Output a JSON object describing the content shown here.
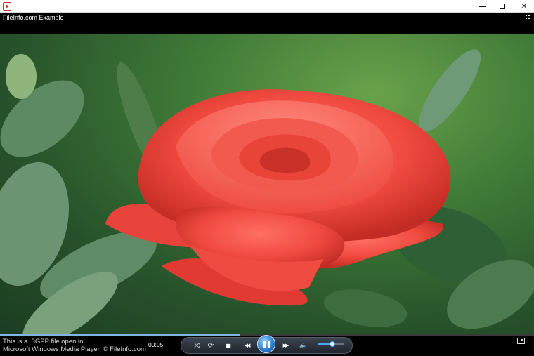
{
  "window": {
    "title": "",
    "controls": {
      "minimize_icon": "minimize-icon",
      "maximize_icon": "maximize-icon",
      "close_glyph": "✕"
    }
  },
  "header": {
    "title": "FileInfo.com Example"
  },
  "video": {
    "subject": "red-rose-image"
  },
  "playback": {
    "progress": 0.45,
    "elapsed": "00:05",
    "volume": 0.55
  },
  "caption": {
    "line1": "This is a .3GPP file open in",
    "line2": "Microsoft Windows Media Player. © FileInfo.com"
  },
  "buttons": {
    "shuffle_glyph": "⤮",
    "repeat_glyph": "⟳",
    "stop_glyph": "■",
    "previous_glyph": "◀◀",
    "next_glyph": "▶▶",
    "mute_glyph": "🔈"
  },
  "colors": {
    "accent": "#2c7fd0",
    "seek_fill": "#7fb6e6"
  }
}
